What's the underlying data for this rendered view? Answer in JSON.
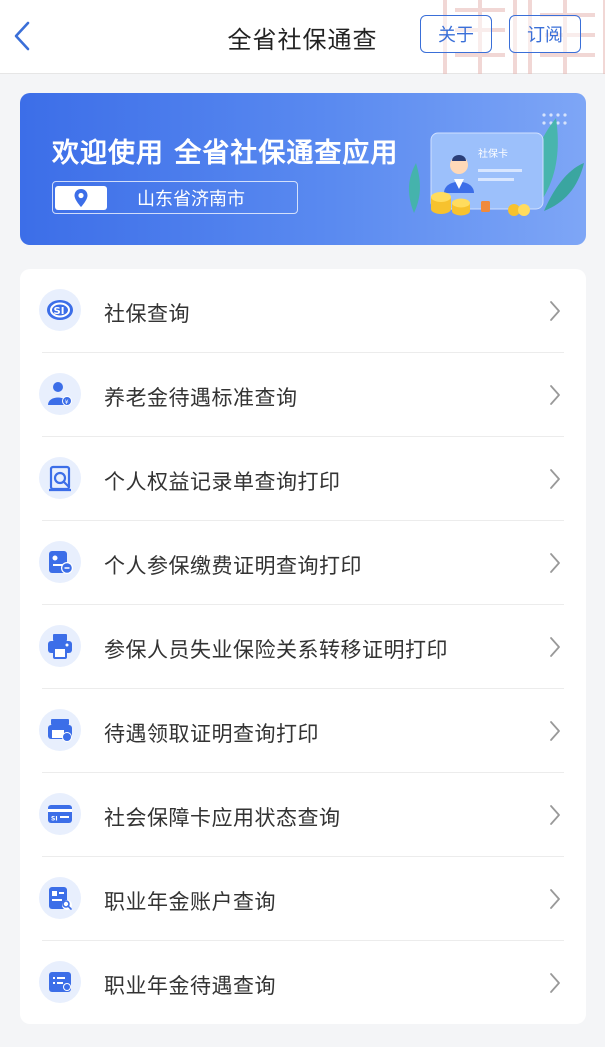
{
  "header": {
    "title": "全省社保通查",
    "about_label": "关于",
    "subscribe_label": "订阅"
  },
  "banner": {
    "welcome": "欢迎使用 全省社保通查应用",
    "location": "山东省济南市",
    "card_text": "社保卡"
  },
  "menu": {
    "items": [
      {
        "label": "社保查询",
        "icon": "si-logo-icon"
      },
      {
        "label": "养老金待遇标准查询",
        "icon": "pension-person-icon"
      },
      {
        "label": "个人权益记录单查询打印",
        "icon": "record-search-icon"
      },
      {
        "label": "个人参保缴费证明查询打印",
        "icon": "payment-certificate-icon"
      },
      {
        "label": "参保人员失业保险关系转移证明打印",
        "icon": "printer-icon"
      },
      {
        "label": "待遇领取证明查询打印",
        "icon": "benefit-printer-icon"
      },
      {
        "label": "社会保障卡应用状态查询",
        "icon": "si-card-icon"
      },
      {
        "label": "职业年金账户查询",
        "icon": "annuity-account-icon"
      },
      {
        "label": "职业年金待遇查询",
        "icon": "annuity-benefit-icon"
      }
    ]
  },
  "colors": {
    "accent": "#3a6fd8",
    "banner_start": "#3c6ee8",
    "banner_end": "#7ea6f6",
    "icon_bg": "#e8effd"
  }
}
